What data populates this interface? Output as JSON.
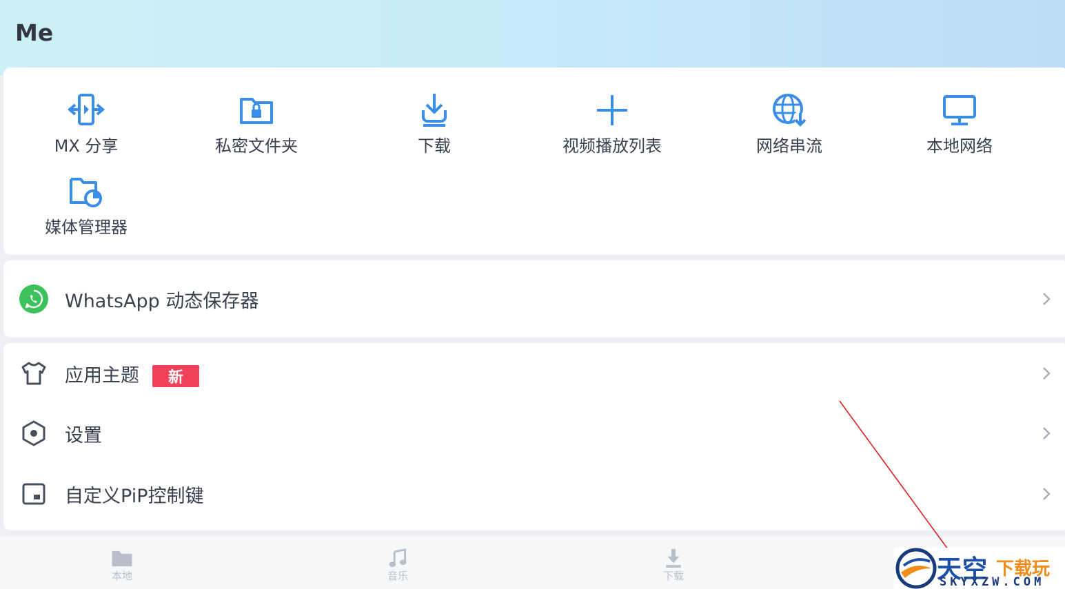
{
  "header": {
    "title": "Me"
  },
  "grid": {
    "items": [
      {
        "label": "MX 分享",
        "icon": "mx-share-icon"
      },
      {
        "label": "私密文件夹",
        "icon": "private-folder-icon"
      },
      {
        "label": "下载",
        "icon": "download-icon"
      },
      {
        "label": "视频播放列表",
        "icon": "plus-icon"
      },
      {
        "label": "网络串流",
        "icon": "network-stream-icon"
      },
      {
        "label": "本地网络",
        "icon": "monitor-icon"
      },
      {
        "label": "媒体管理器",
        "icon": "media-manager-icon"
      }
    ]
  },
  "whatsapp": {
    "label": "WhatsApp 动态保存器",
    "icon": "whatsapp-icon"
  },
  "settings": {
    "items": [
      {
        "label": "应用主题",
        "badge": "新",
        "icon": "shirt-icon"
      },
      {
        "label": "设置",
        "icon": "gear-hexagon-icon"
      },
      {
        "label": "自定义PiP控制键",
        "icon": "pip-icon"
      }
    ]
  },
  "bottom_nav": {
    "tabs": [
      {
        "label": "本地",
        "icon": "folder-icon"
      },
      {
        "label": "音乐",
        "icon": "music-icon"
      },
      {
        "label": "下载",
        "icon": "download-icon"
      }
    ]
  },
  "watermark": {
    "big": "天空",
    "small": "下载玩",
    "url": "SKYXZW.COM"
  },
  "colors": {
    "accent": "#3a8ee6",
    "badge": "#f0405a",
    "whatsapp": "#3cc25a",
    "text": "#3c4150",
    "inactive_tab": "#b9bec8"
  }
}
